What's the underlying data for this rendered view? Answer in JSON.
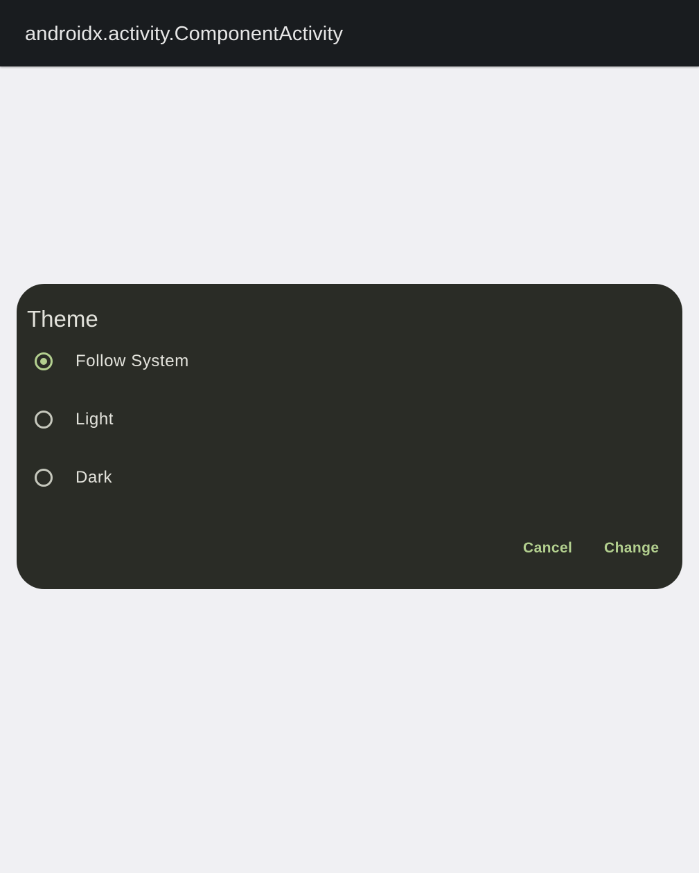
{
  "app_bar": {
    "title": "androidx.activity.ComponentActivity"
  },
  "dialog": {
    "title": "Theme",
    "options": [
      {
        "label": "Follow System",
        "selected": true
      },
      {
        "label": "Light",
        "selected": false
      },
      {
        "label": "Dark",
        "selected": false
      }
    ],
    "cancel_label": "Cancel",
    "confirm_label": "Change"
  },
  "colors": {
    "app_bar_bg": "#191c1f",
    "screen_bg": "#f0f0f3",
    "dialog_bg": "#2a2c26",
    "accent": "#b3d08f",
    "text": "#e3e3dc"
  }
}
